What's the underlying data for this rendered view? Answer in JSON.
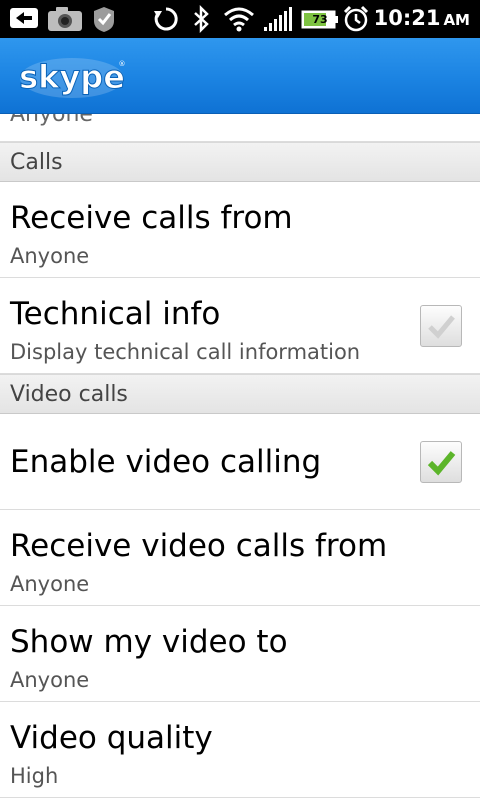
{
  "status_bar": {
    "time": "10:21",
    "ampm": "AM",
    "battery": "73",
    "icons": [
      "back-arrow-icon",
      "camera-icon",
      "checkmark-badge-icon",
      "sync-icon",
      "bluetooth-icon",
      "wifi-icon",
      "signal-icon",
      "battery-icon",
      "alarm-icon"
    ]
  },
  "header": {
    "logo_text": "skype",
    "brand_color": "#1b83e2"
  },
  "list": {
    "partial_row": "Anyone",
    "sections": [
      {
        "header": "Calls",
        "items": [
          {
            "title": "Receive calls from",
            "summary": "Anyone"
          },
          {
            "title": "Technical info",
            "summary": "Display technical call information",
            "checked": false
          }
        ]
      },
      {
        "header": "Video calls",
        "items": [
          {
            "title": "Enable video calling",
            "checked": true
          },
          {
            "title": "Receive video calls from",
            "summary": "Anyone"
          },
          {
            "title": "Show my video to",
            "summary": "Anyone"
          },
          {
            "title": "Video quality",
            "summary": "High"
          }
        ]
      }
    ]
  }
}
